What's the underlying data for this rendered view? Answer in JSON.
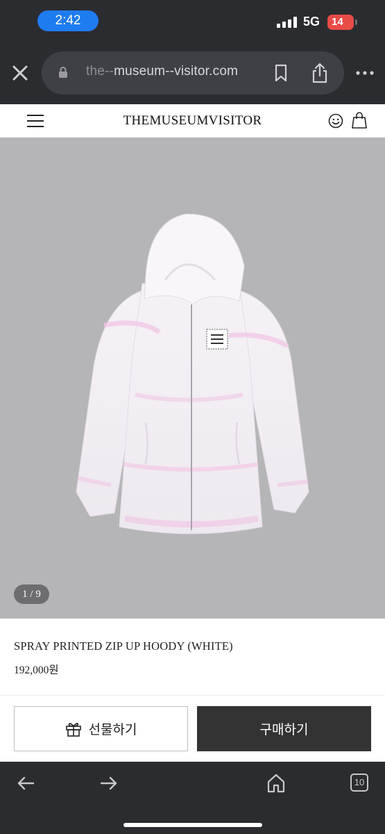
{
  "status_bar": {
    "time": "2:42",
    "network": "5G",
    "battery": "14",
    "signal_level": "4/4"
  },
  "browser": {
    "url_prefix": "the--",
    "url_main": "museum--visitor.com",
    "icons": [
      "close-icon",
      "lock-icon",
      "bookmark-icon",
      "share-icon",
      "more-icon"
    ]
  },
  "site": {
    "title": "THEMUSEUMVISITOR",
    "icons": [
      "menu-icon",
      "smile-icon",
      "bag-icon"
    ]
  },
  "gallery": {
    "counter": "1 / 9"
  },
  "product": {
    "name": "SPRAY PRINTED ZIP UP HOODY (WHITE)",
    "price": "192,000원"
  },
  "actions": {
    "gift_label": "선물하기",
    "buy_label": "구매하기"
  },
  "bottom_bar": {
    "tabs_count": "10",
    "icons": [
      "back-icon",
      "forward-icon",
      "home-icon",
      "tabs-icon"
    ]
  },
  "colors": {
    "chrome": "#2b2c30",
    "time_pill": "#1f7cf0",
    "battery": "#e94b47",
    "image_bg": "#b5b5b7",
    "buy_button": "#333333"
  }
}
